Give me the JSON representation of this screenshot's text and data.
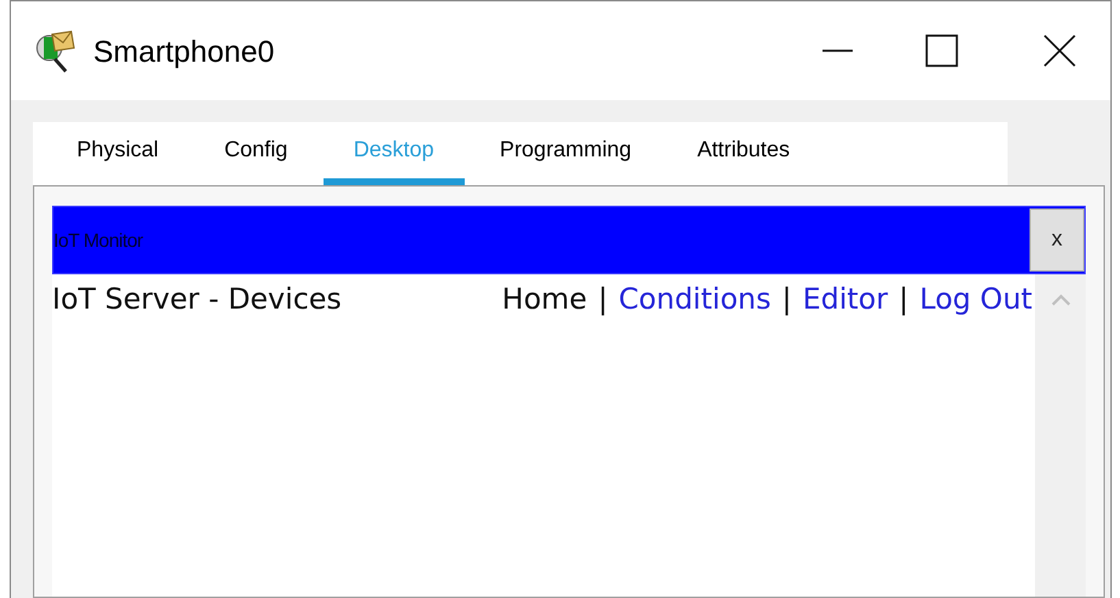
{
  "window": {
    "title": "Smartphone0"
  },
  "tabs": [
    {
      "label": "Physical",
      "selected": false
    },
    {
      "label": "Config",
      "selected": false
    },
    {
      "label": "Desktop",
      "selected": true
    },
    {
      "label": "Programming",
      "selected": false
    },
    {
      "label": "Attributes",
      "selected": false
    }
  ],
  "app": {
    "title": "IoT Monitor",
    "close_label": "x"
  },
  "page": {
    "heading": "IoT Server - Devices",
    "separator": "|",
    "nav": [
      {
        "label": "Home",
        "selected": true
      },
      {
        "label": "Conditions",
        "selected": false
      },
      {
        "label": "Editor",
        "selected": false
      },
      {
        "label": "Log Out",
        "selected": false
      }
    ]
  }
}
